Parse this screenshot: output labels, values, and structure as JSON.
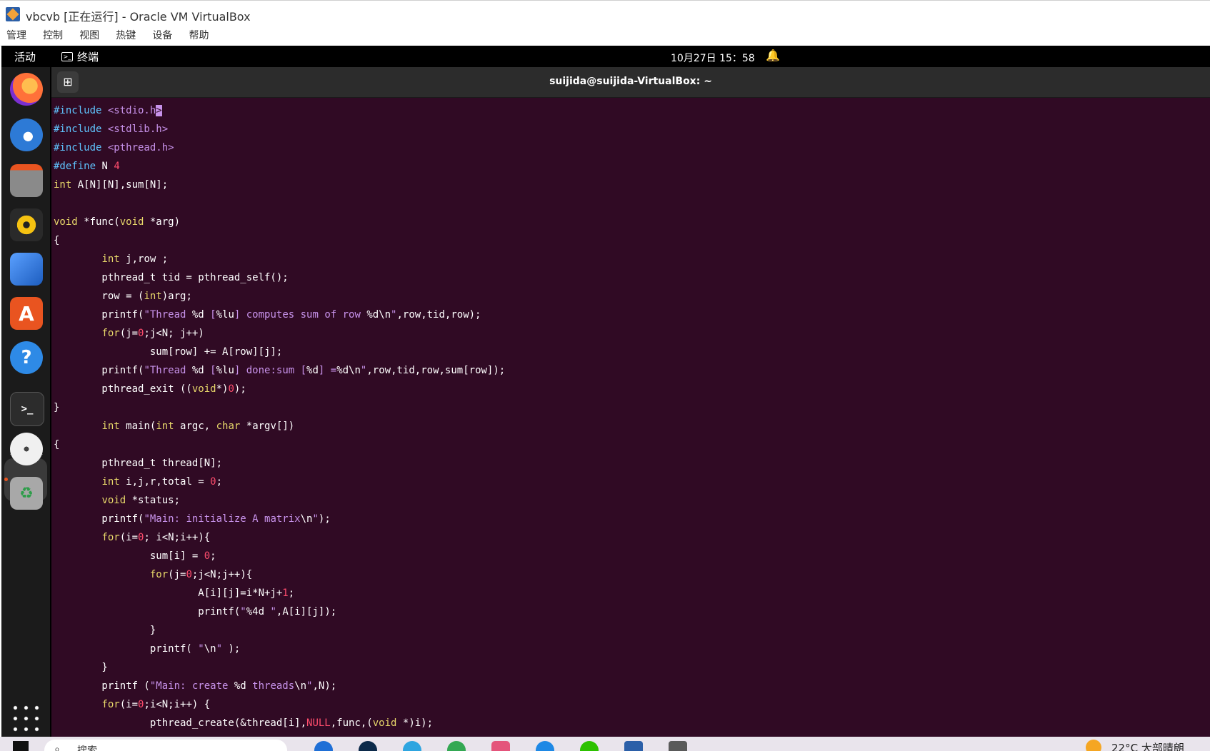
{
  "window": {
    "title": "vbcvb [正在运行] - Oracle VM VirtualBox"
  },
  "menubar": {
    "items": [
      "管理",
      "控制",
      "视图",
      "热键",
      "设备",
      "帮助"
    ]
  },
  "topbar": {
    "activities": "活动",
    "app_name": "终端",
    "app_icon_glyph": ">_",
    "clock": "10月27日  15：58",
    "bell_glyph": "🔔"
  },
  "dock": {
    "apps": [
      {
        "name": "firefox-icon",
        "color": "#ff7139"
      },
      {
        "name": "thunderbird-icon",
        "color": "#2d7ad6"
      },
      {
        "name": "files-icon",
        "color": "#7a7a7a"
      },
      {
        "name": "rhythmbox-icon",
        "color": "#f5c211"
      },
      {
        "name": "libreoffice-writer-icon",
        "color": "#2a6bd1"
      },
      {
        "name": "app-center-icon",
        "color": "#e95420"
      },
      {
        "name": "help-icon",
        "color": "#2e8ae6"
      },
      {
        "name": "terminal-icon",
        "color": "#2c2c2c"
      },
      {
        "name": "disc-icon",
        "color": "#dcdcdc"
      },
      {
        "name": "trash-icon",
        "color": "#9e9e9e"
      },
      {
        "name": "show-apps-icon",
        "color": "#1b1b1b"
      }
    ],
    "help_glyph": "?",
    "terminal_glyph": ">_",
    "app_center_glyph": "A",
    "trash_glyph": "♻"
  },
  "terminal": {
    "title": "suijida@suijida-VirtualBox: ~",
    "new_tab_glyph": "⊞"
  },
  "taskbar": {
    "search_placeholder": "搜索",
    "search_icon_glyph": "⌕",
    "weather": "22°C  大部晴朗"
  }
}
